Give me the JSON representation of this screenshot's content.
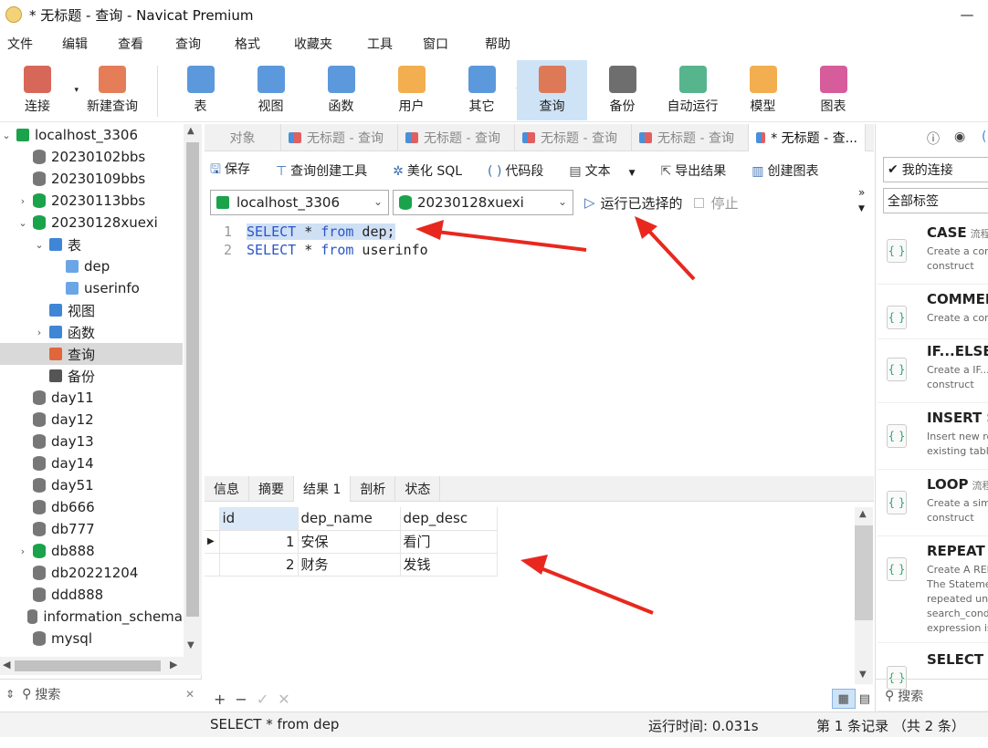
{
  "window": {
    "title": "* 无标题 - 查询 - Navicat Premium",
    "minimize": "—",
    "maximize": "☐",
    "close": "✕"
  },
  "menu": [
    "文件",
    "编辑",
    "查看",
    "查询",
    "格式",
    "收藏夹",
    "工具",
    "窗口",
    "帮助"
  ],
  "toolbar": [
    {
      "label": "连接",
      "icon": "plug-icon",
      "color": "#d04c3c"
    },
    {
      "label": "新建查询",
      "icon": "new-query-icon",
      "color": "#e0663c"
    },
    {
      "label": "表",
      "icon": "table-icon",
      "color": "#3f86d6"
    },
    {
      "label": "视图",
      "icon": "view-icon",
      "color": "#3f86d6"
    },
    {
      "label": "函数",
      "icon": "function-icon",
      "color": "#3f86d6"
    },
    {
      "label": "用户",
      "icon": "user-icon",
      "color": "#f0a030"
    },
    {
      "label": "其它",
      "icon": "tools-icon",
      "color": "#3f86d6"
    },
    {
      "label": "查询",
      "icon": "query-icon",
      "color": "#e0663c"
    },
    {
      "label": "备份",
      "icon": "backup-icon",
      "color": "#555555"
    },
    {
      "label": "自动运行",
      "icon": "robot-icon",
      "color": "#3aa87a"
    },
    {
      "label": "模型",
      "icon": "model-icon",
      "color": "#f0a030"
    },
    {
      "label": "图表",
      "icon": "chart-icon",
      "color": "#d0408a"
    }
  ],
  "tree": [
    {
      "label": "localhost_3306",
      "type": "conn",
      "arrow": "⌄",
      "indent": 0
    },
    {
      "label": "20230102bbs",
      "type": "db",
      "arrow": "",
      "indent": 1
    },
    {
      "label": "20230109bbs",
      "type": "db",
      "arrow": "",
      "indent": 1
    },
    {
      "label": "20230113bbs",
      "type": "dbgreen",
      "arrow": "›",
      "indent": 1
    },
    {
      "label": "20230128xuexi",
      "type": "dbgreen",
      "arrow": "⌄",
      "indent": 1
    },
    {
      "label": "表",
      "type": "tables",
      "arrow": "⌄",
      "indent": 2
    },
    {
      "label": "dep",
      "type": "table",
      "arrow": "",
      "indent": 3
    },
    {
      "label": "userinfo",
      "type": "table",
      "arrow": "",
      "indent": 3
    },
    {
      "label": "视图",
      "type": "view",
      "arrow": "",
      "indent": 2
    },
    {
      "label": "函数",
      "type": "func",
      "arrow": "›",
      "indent": 2
    },
    {
      "label": "查询",
      "type": "query",
      "arrow": "",
      "indent": 2,
      "selected": true
    },
    {
      "label": "备份",
      "type": "backup",
      "arrow": "",
      "indent": 2
    },
    {
      "label": "day11",
      "type": "db",
      "arrow": "",
      "indent": 1
    },
    {
      "label": "day12",
      "type": "db",
      "arrow": "",
      "indent": 1
    },
    {
      "label": "day13",
      "type": "db",
      "arrow": "",
      "indent": 1
    },
    {
      "label": "day14",
      "type": "db",
      "arrow": "",
      "indent": 1
    },
    {
      "label": "day51",
      "type": "db",
      "arrow": "",
      "indent": 1
    },
    {
      "label": "db666",
      "type": "db",
      "arrow": "",
      "indent": 1
    },
    {
      "label": "db777",
      "type": "db",
      "arrow": "",
      "indent": 1
    },
    {
      "label": "db888",
      "type": "dbgreen",
      "arrow": "›",
      "indent": 1
    },
    {
      "label": "db20221204",
      "type": "db",
      "arrow": "",
      "indent": 1
    },
    {
      "label": "ddd888",
      "type": "db",
      "arrow": "",
      "indent": 1
    },
    {
      "label": "information_schema",
      "type": "db",
      "arrow": "",
      "indent": 1
    },
    {
      "label": "mysql",
      "type": "db",
      "arrow": "",
      "indent": 1
    }
  ],
  "sidebar_search": "搜索",
  "tabs": [
    {
      "label": "对象",
      "active": false,
      "icon": false
    },
    {
      "label": "无标题 - 查询",
      "active": false,
      "icon": true
    },
    {
      "label": "无标题 - 查询",
      "active": false,
      "icon": true
    },
    {
      "label": "无标题 - 查询",
      "active": false,
      "icon": true
    },
    {
      "label": "无标题 - 查询",
      "active": false,
      "icon": true
    },
    {
      "label": "* 无标题 - 查...",
      "active": true,
      "icon": true
    }
  ],
  "query_toolbar": [
    "保存",
    "查询创建工具",
    "美化 SQL",
    "代码段",
    "文本",
    "导出结果",
    "创建图表"
  ],
  "connection": "localhost_3306",
  "database": "20230128xuexi",
  "run_selected": "运行已选择的",
  "stop": "停止",
  "code": [
    {
      "n": "1",
      "kw1": "SELECT",
      "mid": " * ",
      "kw2": "from",
      "rest": " dep;"
    },
    {
      "n": "2",
      "kw1": "SELECT",
      "mid": " * ",
      "kw2": "from",
      "rest": " userinfo"
    }
  ],
  "result_tabs": [
    "信息",
    "摘要",
    "结果 1",
    "剖析",
    "状态"
  ],
  "result": {
    "columns": [
      "id",
      "dep_name",
      "dep_desc"
    ],
    "rows": [
      [
        "1",
        "安保",
        "看门"
      ],
      [
        "2",
        "财务",
        "发钱"
      ]
    ]
  },
  "grid_footer": [
    "+",
    "−",
    "✓",
    "✕"
  ],
  "status": {
    "sql": "SELECT * from dep",
    "time": "运行时间: 0.031s",
    "records": "第 1 条记录 （共 2 条）"
  },
  "right_panel": {
    "connection_select": "我的连接",
    "tags_select": "全部标签",
    "search": "搜索",
    "snippets": [
      {
        "title": "CASE",
        "tag": "流程",
        "desc": [
          "Create a cond",
          "construct"
        ]
      },
      {
        "title": "COMMEN",
        "tag": "",
        "desc": [
          "Create a com"
        ]
      },
      {
        "title": "IF...ELSE...",
        "tag": "",
        "desc": [
          "Create a IF...E",
          "construct"
        ]
      },
      {
        "title": "INSERT S",
        "tag": "",
        "desc": [
          "Insert new ro",
          "existing table"
        ]
      },
      {
        "title": "LOOP",
        "tag": "流程",
        "desc": [
          "Create a simp",
          "construct"
        ]
      },
      {
        "title": "REPEAT",
        "tag": "流",
        "desc": [
          "Create A REP",
          "The Statemen",
          "repeated unt",
          "search_cond",
          "expression is"
        ]
      },
      {
        "title": "SELECT S",
        "tag": "",
        "desc": []
      }
    ]
  }
}
